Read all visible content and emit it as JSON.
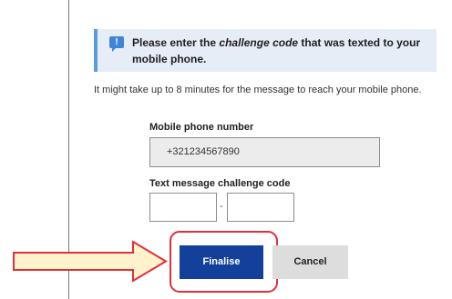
{
  "info": {
    "icon": "info-icon",
    "icon_glyph": "!",
    "text_before": "Please enter the ",
    "text_italic": "challenge code",
    "text_after": " that was texted to your mobile phone."
  },
  "note": "It might take up to 8 minutes for the message to reach your mobile phone.",
  "phone": {
    "label": "Mobile phone number",
    "value": "+321234567890"
  },
  "code": {
    "label": "Text message challenge code",
    "separator": "-",
    "value_1": "",
    "value_2": ""
  },
  "buttons": {
    "finalise": "Finalise",
    "cancel": "Cancel"
  },
  "colors": {
    "accent": "#12409a",
    "info_bar": "#5c9be0",
    "highlight": "#e0303a",
    "arrow_fill": "#fff2cc"
  }
}
